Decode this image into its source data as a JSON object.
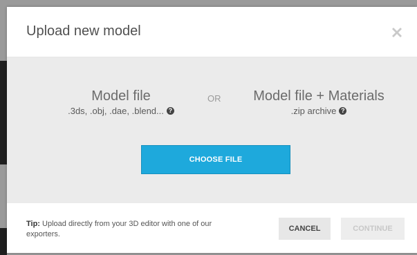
{
  "modal": {
    "title": "Upload new model",
    "close_icon": "close-x-icon"
  },
  "options": {
    "single": {
      "title": "Model file",
      "subtitle": ".3ds, .obj, .dae, .blend...",
      "help_icon": "question-circle-icon"
    },
    "separator": "OR",
    "archive": {
      "title": "Model file + Materials",
      "subtitle": ".zip archive",
      "help_icon": "question-circle-icon"
    },
    "choose_button": "CHOOSE FILE"
  },
  "footer": {
    "tip_label": "Tip:",
    "tip_text": " Upload directly from your 3D editor with one of our exporters.",
    "cancel_button": "CANCEL",
    "continue_button": "CONTINUE"
  },
  "colors": {
    "accent": "#1ea9dc",
    "drop_area_bg": "#ebebeb"
  }
}
